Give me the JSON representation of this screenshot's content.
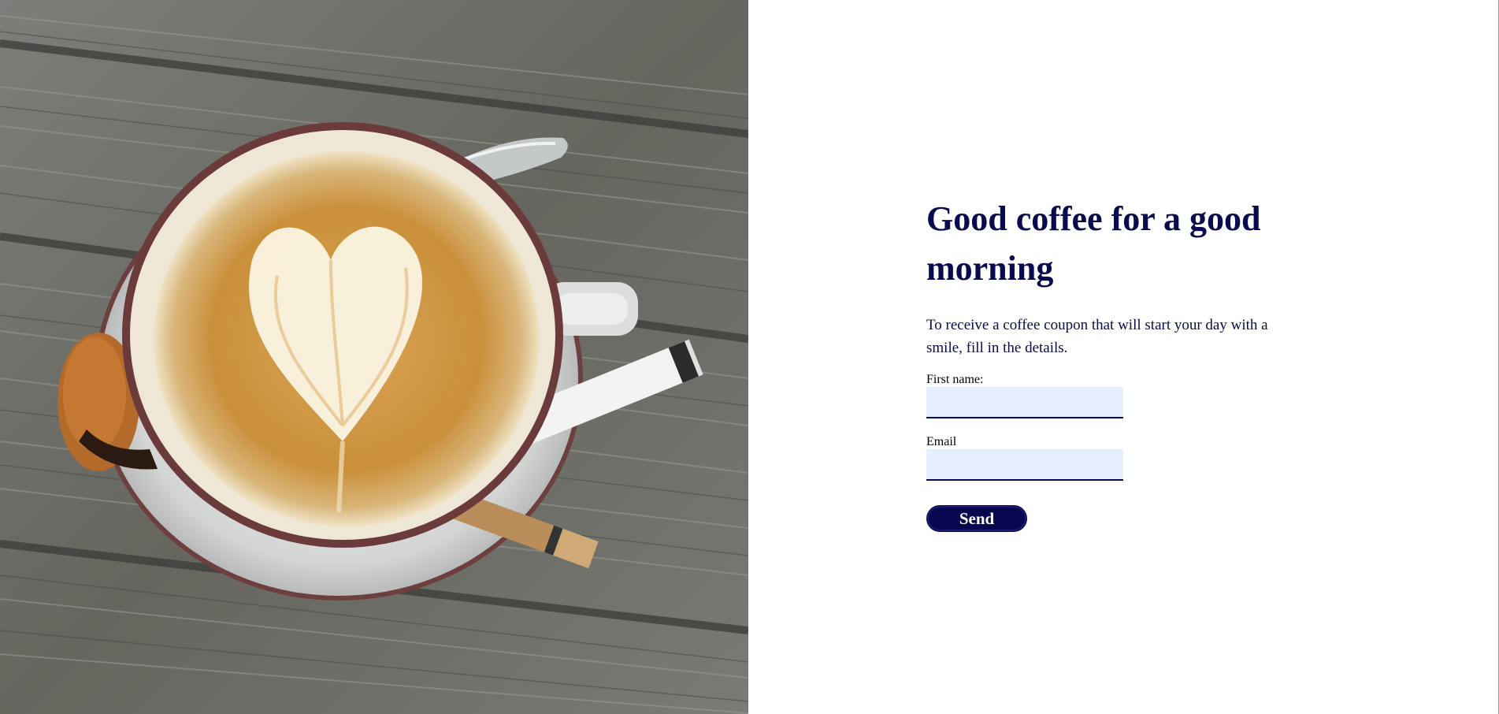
{
  "hero": {
    "image": "latte-art-coffee-cup-on-wooden-table",
    "colors": {
      "wood": "#6e6e6c",
      "coffee": "#c9923e",
      "foam": "#f3ead5",
      "rim": "#6b3a3a"
    }
  },
  "form": {
    "title": "Good coffee for a good morning",
    "description": "To receive a coffee coupon that will start your day with a smile, fill in the details.",
    "first_name_label": "First name:",
    "first_name_value": "",
    "email_label": "Email",
    "email_value": "",
    "submit_label": "Send"
  },
  "colors": {
    "primary": "#0a0a4e",
    "button": "#070750",
    "field_bg": "#e6efff"
  }
}
